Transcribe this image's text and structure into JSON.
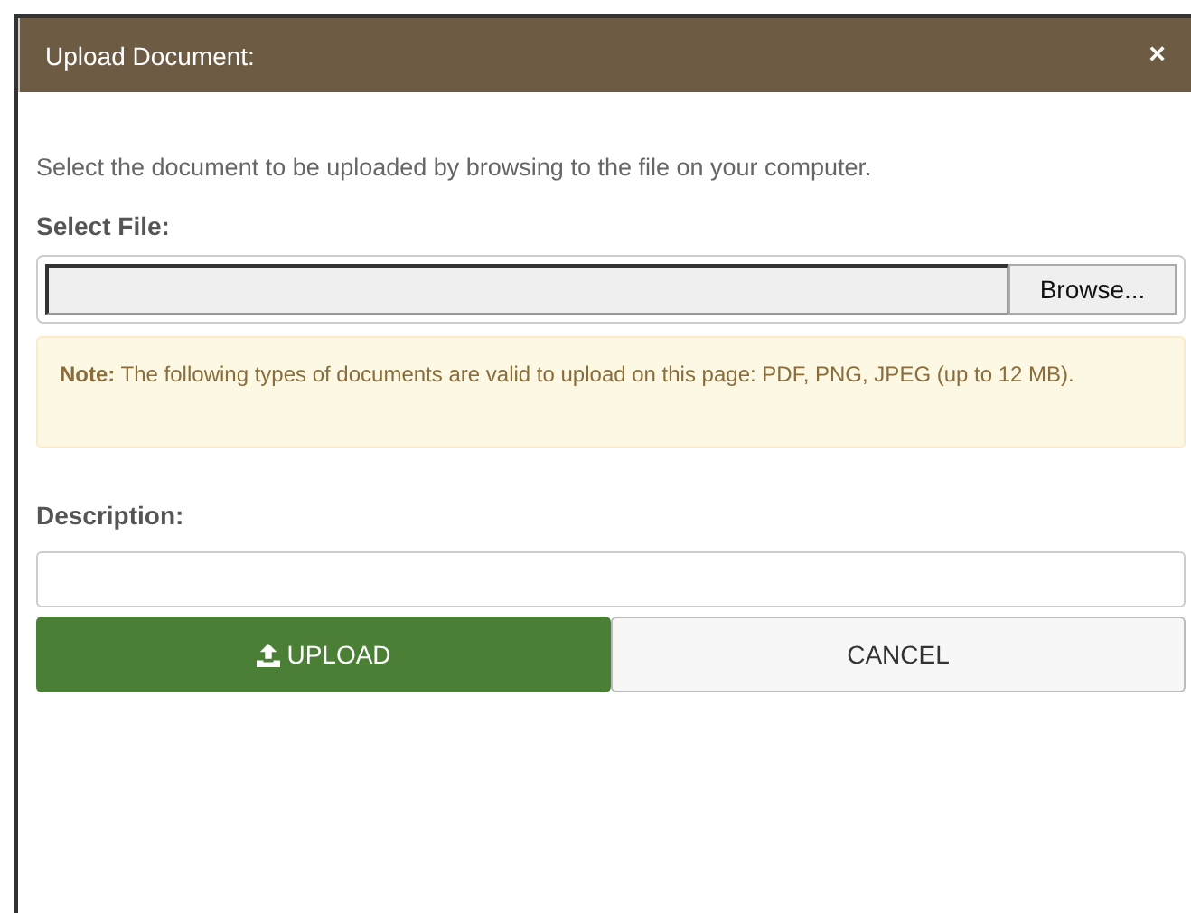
{
  "dialog": {
    "title": "Upload Document:",
    "close": "×"
  },
  "intro": "Select the document to be uploaded by browsing to the file on your computer.",
  "file": {
    "label": "Select File:",
    "browse": "Browse..."
  },
  "note": "**Note:** The following types of documents are valid to upload on this page: PDF, PNG, JPEG (up to 12 MB).",
  "description": {
    "label": "Description:"
  },
  "buttons": [
    {
      "kind": "primary",
      "label": "UPLOAD"
    },
    {
      "kind": "secondary",
      "label": "CANCEL"
    }
  ]
}
